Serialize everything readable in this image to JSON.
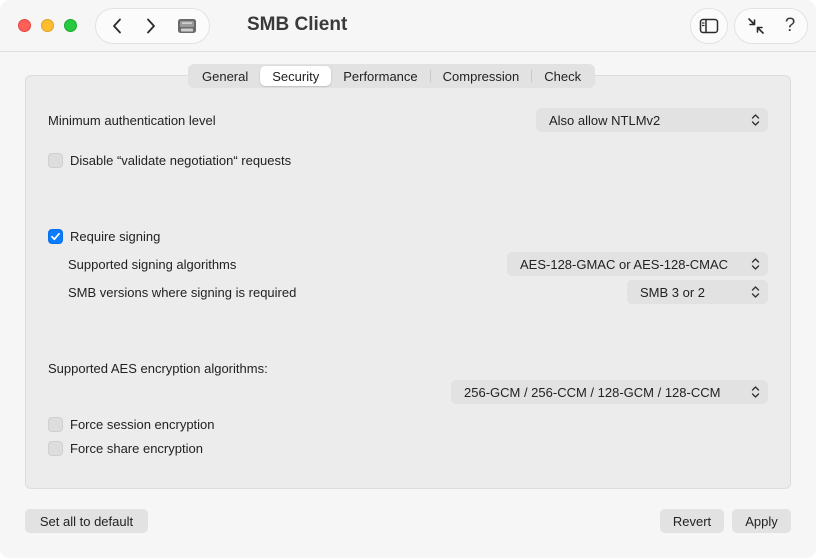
{
  "window": {
    "title": "SMB Client"
  },
  "tabs": [
    {
      "label": "General",
      "active": false
    },
    {
      "label": "Security",
      "active": true
    },
    {
      "label": "Performance",
      "active": false
    },
    {
      "label": "Compression",
      "active": false
    },
    {
      "label": "Check",
      "active": false
    }
  ],
  "security": {
    "min_auth_label": "Minimum authentication level",
    "min_auth_value": "Also allow NTLMv2",
    "disable_validate_label": "Disable “validate negotiation“ requests",
    "disable_validate_checked": false,
    "require_signing_label": "Require signing",
    "require_signing_checked": true,
    "signing_algorithms_label": "Supported signing algorithms",
    "signing_algorithms_value": "AES-128-GMAC or AES-128-CMAC",
    "signing_versions_label": "SMB versions where signing is required",
    "signing_versions_value": "SMB 3 or 2",
    "aes_label": "Supported AES encryption algorithms:",
    "aes_value": "256-GCM / 256-CCM / 128-GCM / 128-CCM",
    "force_session_label": "Force session encryption",
    "force_session_checked": false,
    "force_share_label": "Force share encryption",
    "force_share_checked": false
  },
  "footer": {
    "default_label": "Set all to default",
    "revert_label": "Revert",
    "apply_label": "Apply"
  },
  "icons": {
    "back": "chevron-left-icon",
    "forward": "chevron-right-icon",
    "app": "network-drive-icon",
    "sidebar": "sidebar-icon",
    "collapse": "arrows-collapse-icon",
    "help": "?"
  },
  "colors": {
    "accent": "#0a7cff",
    "close": "#fe5f57",
    "minimize": "#febc2e",
    "maximize": "#28c840"
  }
}
